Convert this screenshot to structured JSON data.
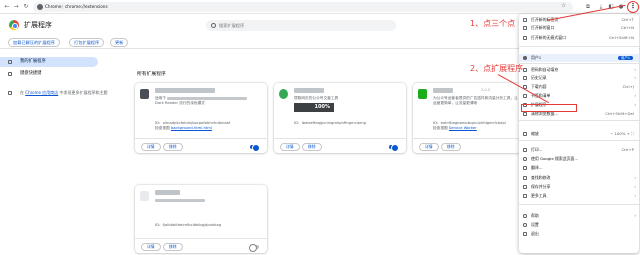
{
  "browser": {
    "omnibox_chip": "Chrome",
    "omnibox_sep": "|",
    "url": "chrome://extensions",
    "nav": {
      "back": "←",
      "forward": "→",
      "reload": "↻",
      "home": "⌂"
    },
    "icons": {
      "star": "☆",
      "ext": "⧉",
      "download": "⤓",
      "sidebar": "◧",
      "profile": "●",
      "menu": "⋮"
    }
  },
  "header": {
    "title": "扩展程序",
    "search_placeholder": "搜索扩展程序",
    "dev_mode": ""
  },
  "subbar": {
    "load_unpacked": "加载已解压的扩展程序",
    "pack": "打包扩展程序",
    "update": "更新"
  },
  "sidebar": {
    "items": [
      {
        "label": "我的扩展程序"
      },
      {
        "label": "键盘快捷键"
      }
    ],
    "note_prefix": "在 ",
    "note_link": "Chrome 应用商店",
    "note_suffix": " 中发现更多扩展程序和主题"
  },
  "main": {
    "section_title": "所有扩展程序",
    "cards": [
      {
        "version": "",
        "desc_start": "适用于",
        "desc_line2": "Dark Reader 流行的深色模式",
        "id_label": "ID：",
        "id": "oimadpkcfehdnjbocpofebhnhdbniaaf",
        "view_label": "检查视图 ",
        "view_link": "background.html.html",
        "detail": "详情",
        "remove": "移除",
        "percent": ""
      },
      {
        "version": "",
        "desc_start": "",
        "desc_line2": "提取网页的公众号文章工具",
        "id_label": "ID：",
        "id": "ibelaeffaqjpcnnigmkphffngmclpmg",
        "view_label": "",
        "view_link": "",
        "detail": "详情",
        "remove": "移除",
        "percent": "100%"
      },
      {
        "version": "2.0.0",
        "desc_start": "",
        "desc_line2": "为公众号运营者提供的广告插件和流量分析工具，让运营更简单，让流量更清晰",
        "id_label": "ID：",
        "id": "eahrfbogbamobcplciphfdgecifcbdpl",
        "view_label": "检查视图 ",
        "view_link": "Service Worker",
        "detail": "详情",
        "remove": "移除",
        "percent": ""
      },
      {
        "version": "",
        "desc_start": "",
        "desc_line2": "",
        "id_label": "ID：",
        "id": "fjolbbbitbeimfbcibbibgjdpnbkag",
        "view_label": "",
        "view_link": "",
        "detail": "详情",
        "remove": "移除",
        "percent": ""
      }
    ]
  },
  "annotations": {
    "step1": "1、点三个点",
    "step2": "2、点扩展程序"
  },
  "menu": {
    "new_tab": "打开新的标签页",
    "new_tab_sc": "Ctrl+T",
    "new_window": "打开新的窗口",
    "new_window_sc": "Ctrl+N",
    "incognito": "打开新的无痕式窗口",
    "incognito_sc": "Ctrl+Shift+N",
    "profile": "用户1",
    "profile_chip": "用户1",
    "passwords": "密码和自动填充",
    "history": "历史记录",
    "downloads": "下载内容",
    "downloads_sc": "Ctrl+J",
    "bookmarks": "书签和清单",
    "extensions": "扩展程序",
    "clear": "清除浏览数据...",
    "clear_sc": "Ctrl+Shift+Del",
    "zoom": "缩放",
    "zoom_value": "−   100%   +   ⛶",
    "print": "打印...",
    "print_sc": "Ctrl+P",
    "google_search": "使用 Google 搜索此页面...",
    "translate": "翻译...",
    "find": "查找和修改",
    "save_share": "保存并分享",
    "more_tools": "更多工具",
    "help": "帮助",
    "settings": "设置",
    "exit": "退出"
  }
}
